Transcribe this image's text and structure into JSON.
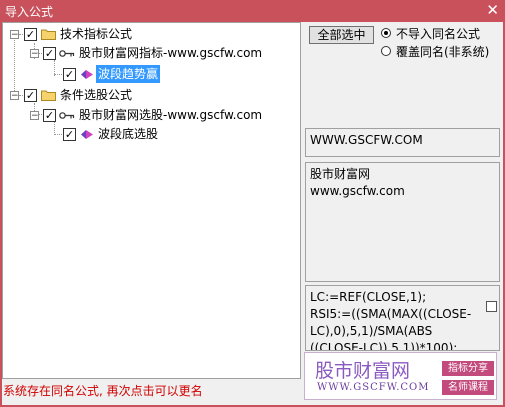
{
  "window": {
    "title": "导入公式",
    "close_glyph": "✕"
  },
  "tree": {
    "groups": [
      {
        "label": "技术指标公式",
        "child": "股市财富网指标-www.gscfw.com",
        "leaf": "波段趋势赢",
        "leaf_selected": true
      },
      {
        "label": "条件选股公式",
        "child": "股市财富网选股-www.gscfw.com",
        "leaf": "波段底选股",
        "leaf_selected": false
      }
    ]
  },
  "options": {
    "select_all_label": "全部选中",
    "radio_skip_label": "不导入同名公式",
    "radio_overwrite_label": "覆盖同名(非系统)",
    "radio_selected": "skip"
  },
  "info": {
    "author_url": "WWW.GSCFW.COM",
    "desc_line1": "股市财富网",
    "desc_line2": "www.gscfw.com",
    "code_lines": [
      "LC:=REF(CLOSE,1);",
      "RSI5:=((SMA(MAX((CLOSE-",
      "LC),0),5,1)/SMA(ABS",
      "((CLOSE-LC)),5,1))*100);"
    ]
  },
  "status": "系统存在同名公式, 再次点击可以更名",
  "watermark": {
    "name": "股市财富网",
    "url": "WWW.GSCFW.COM",
    "tag1": "指标分享",
    "tag2": "名师课程"
  },
  "colors": {
    "titlebar": "#c8515b",
    "selection": "#3399ff",
    "status": "#d00000"
  }
}
